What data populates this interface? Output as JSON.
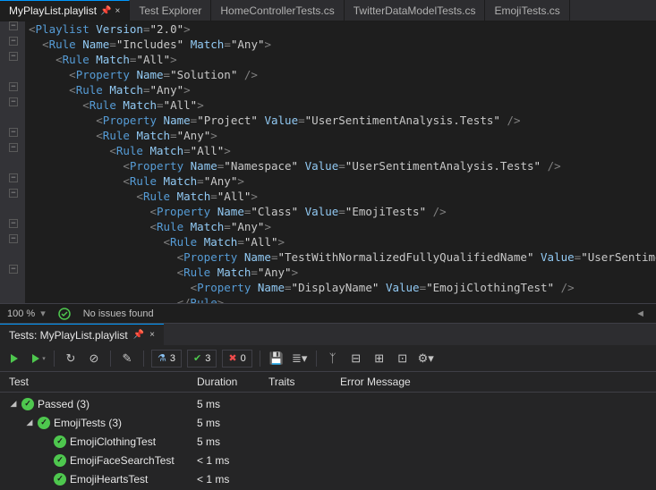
{
  "tabs": {
    "active": "MyPlayList.playlist",
    "others": [
      "Test Explorer",
      "HomeControllerTests.cs",
      "TwitterDataModelTests.cs",
      "EmojiTests.cs"
    ]
  },
  "editor": {
    "lines": [
      {
        "i": 0,
        "raw": "<Playlist Version=\"2.0\">",
        "fold": true
      },
      {
        "i": 1,
        "raw": "<Rule Name=\"Includes\" Match=\"Any\">",
        "fold": true
      },
      {
        "i": 2,
        "raw": "<Rule Match=\"All\">",
        "fold": true
      },
      {
        "i": 3,
        "raw": "<Property Name=\"Solution\" />"
      },
      {
        "i": 3,
        "raw": "<Rule Match=\"Any\">",
        "fold": true
      },
      {
        "i": 4,
        "raw": "<Rule Match=\"All\">",
        "fold": true
      },
      {
        "i": 5,
        "raw": "<Property Name=\"Project\" Value=\"UserSentimentAnalysis.Tests\" />"
      },
      {
        "i": 5,
        "raw": "<Rule Match=\"Any\">",
        "fold": true
      },
      {
        "i": 6,
        "raw": "<Rule Match=\"All\">",
        "fold": true
      },
      {
        "i": 7,
        "raw": "<Property Name=\"Namespace\" Value=\"UserSentimentAnalysis.Tests\" />"
      },
      {
        "i": 7,
        "raw": "<Rule Match=\"Any\">",
        "fold": true
      },
      {
        "i": 8,
        "raw": "<Rule Match=\"All\">",
        "fold": true
      },
      {
        "i": 9,
        "raw": "<Property Name=\"Class\" Value=\"EmojiTests\" />"
      },
      {
        "i": 9,
        "raw": "<Rule Match=\"Any\">",
        "fold": true
      },
      {
        "i": 10,
        "raw": "<Rule Match=\"All\">",
        "fold": true
      },
      {
        "i": 11,
        "raw": "<Property Name=\"TestWithNormalizedFullyQualifiedName\" Value=\"UserSentimentAnalysis.Tests.EmojiTests.EmojiClothingTest\" />"
      },
      {
        "i": 11,
        "raw": "<Rule Match=\"Any\">",
        "fold": true
      },
      {
        "i": 12,
        "raw": "<Property Name=\"DisplayName\" Value=\"EmojiClothingTest\" />"
      },
      {
        "i": 11,
        "raw": "</Rule>"
      }
    ]
  },
  "status": {
    "zoom": "100 %",
    "issues": "No issues found"
  },
  "test_panel": {
    "tab_title": "Tests: MyPlayList.playlist",
    "counts": {
      "total": "3",
      "passed": "3",
      "failed": "0"
    },
    "columns": {
      "test": "Test",
      "duration": "Duration",
      "traits": "Traits",
      "error": "Error Message"
    },
    "rows": [
      {
        "indent": 0,
        "expander": true,
        "label": "Passed (3)",
        "duration": "5 ms"
      },
      {
        "indent": 1,
        "expander": true,
        "label": "EmojiTests (3)",
        "duration": "5 ms"
      },
      {
        "indent": 2,
        "expander": false,
        "label": "EmojiClothingTest",
        "duration": "5 ms"
      },
      {
        "indent": 2,
        "expander": false,
        "label": "EmojiFaceSearchTest",
        "duration": "< 1 ms"
      },
      {
        "indent": 2,
        "expander": false,
        "label": "EmojiHeartsTest",
        "duration": "< 1 ms"
      }
    ]
  }
}
